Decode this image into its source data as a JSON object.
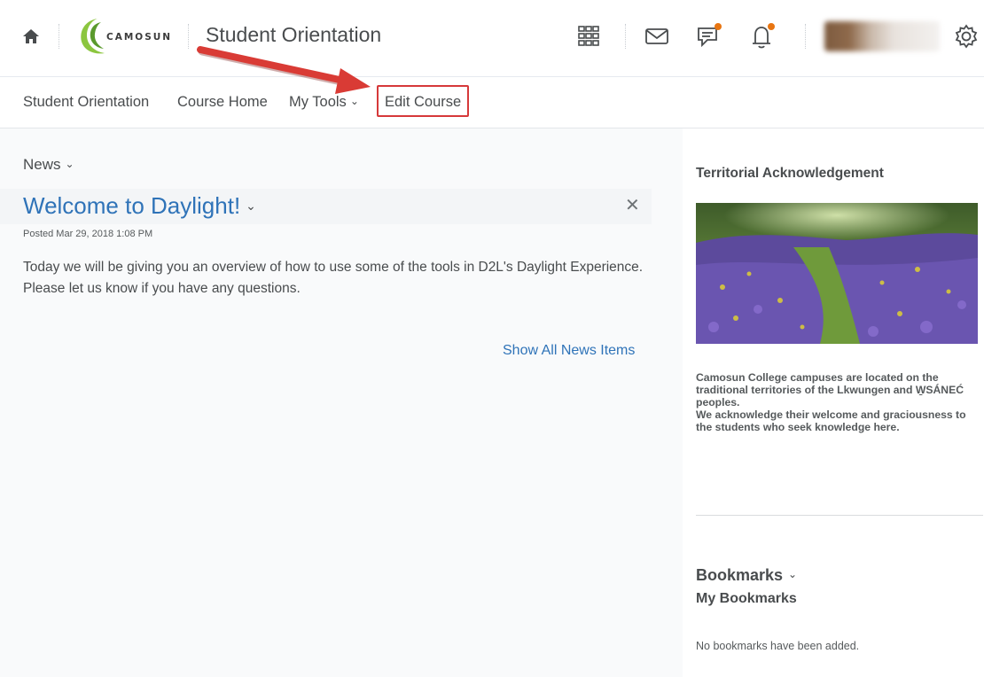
{
  "header": {
    "course_title": "Student Orientation",
    "logo_text": "CAMOSUN",
    "notification_dot_color": "#e87511"
  },
  "nav": {
    "items": [
      {
        "label": "Student Orientation"
      },
      {
        "label": "Course Home"
      },
      {
        "label": "My Tools"
      },
      {
        "label": "Edit Course"
      }
    ]
  },
  "news": {
    "heading": "News",
    "title": "Welcome to Daylight!",
    "posted": "Posted Mar 29, 2018 1:08 PM",
    "body": "Today we will be giving you an overview of how to use some of the tools in D2L's Daylight Experience.  Please let us know if you have any questions.",
    "show_all": "Show All News Items"
  },
  "territorial": {
    "heading": "Territorial Acknowledgement",
    "line1": "Camosun College campuses are located on the traditional territories of the Lkwungen and W̱SÁNEĆ peoples.",
    "line2": "We acknowledge their welcome and graciousness to the students who seek knowledge here."
  },
  "bookmarks": {
    "heading": "Bookmarks",
    "subheading": "My Bookmarks",
    "empty": "No bookmarks have been added."
  },
  "colors": {
    "link": "#2f73b8",
    "highlight": "#d6393a"
  }
}
